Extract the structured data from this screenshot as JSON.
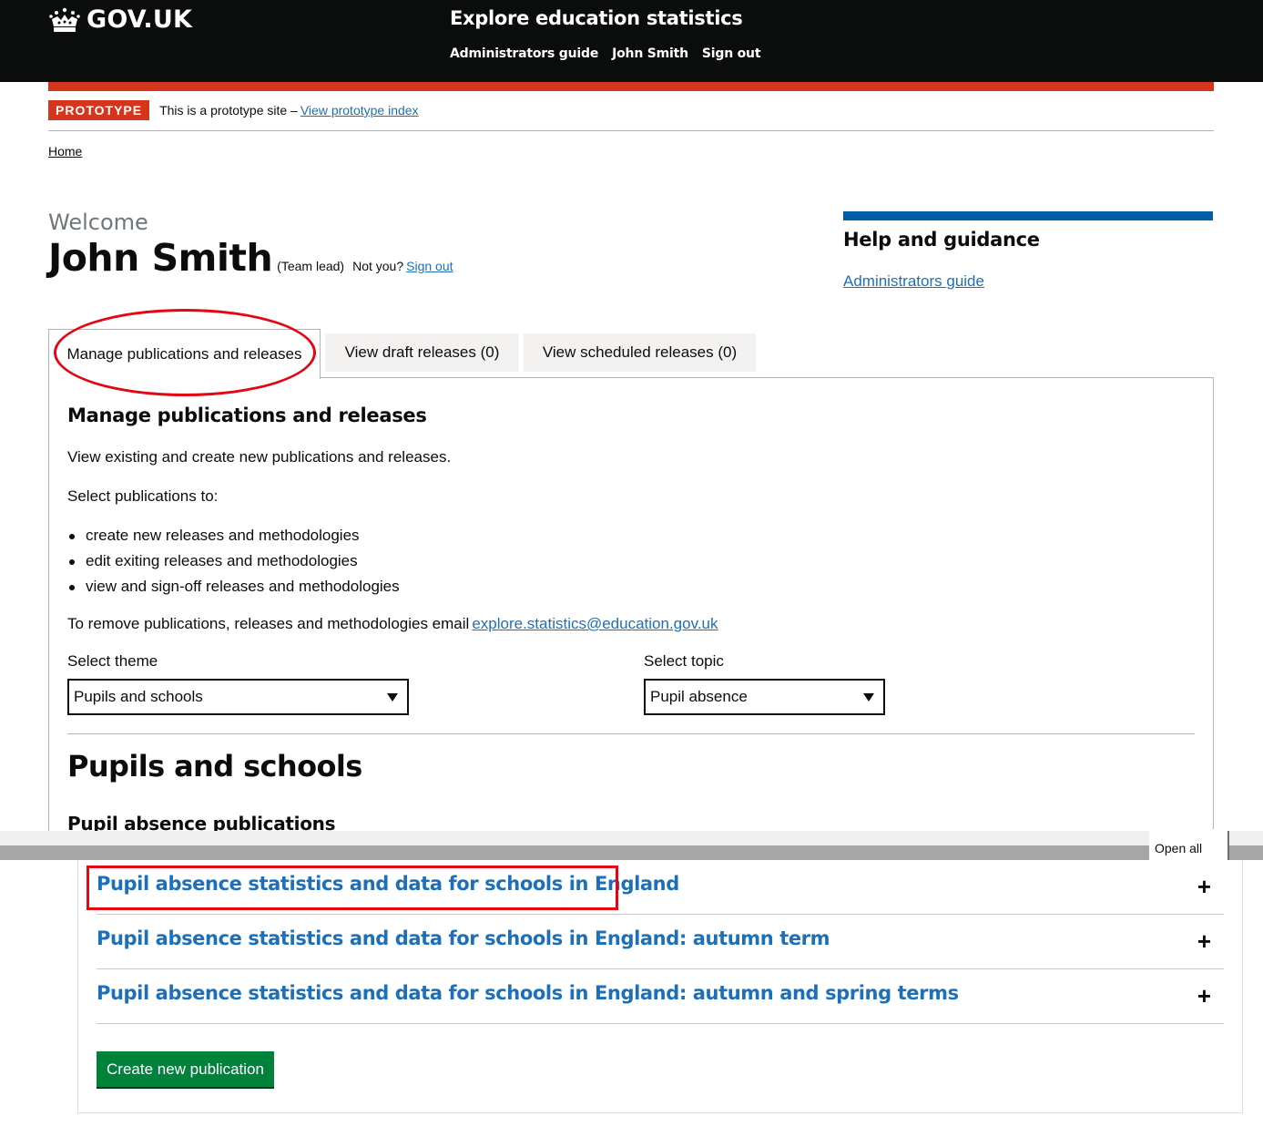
{
  "header": {
    "logo_text": "GOV.UK",
    "service_name": "Explore education statistics",
    "nav": [
      "Administrators guide",
      "John Smith",
      "Sign out"
    ]
  },
  "phase_banner": {
    "tag": "PROTOTYPE",
    "text": "This is a prototype site –",
    "link": "View prototype index"
  },
  "breadcrumb": {
    "home": "Home"
  },
  "welcome": {
    "greeting": "Welcome",
    "name": "John Smith",
    "role": "(Team lead)",
    "not_you": "Not you?",
    "sign_out": "Sign out"
  },
  "help": {
    "title": "Help and guidance",
    "link": "Administrators guide"
  },
  "tabs": [
    {
      "label": "Manage publications and releases",
      "active": true
    },
    {
      "label": "View draft releases (0)",
      "active": false
    },
    {
      "label": "View scheduled releases (0)",
      "active": false
    }
  ],
  "content": {
    "title": "Manage publications and releases",
    "intro": "View existing and create new publications and releases.",
    "select_intro": "Select publications to:",
    "bullets": [
      "create new releases and methodologies",
      "edit exiting releases and methodologies",
      "view and sign-off releases and methodologies"
    ],
    "remove_text": "To remove publications, releases and methodologies email",
    "email": "explore.statistics@education.gov.uk",
    "theme_label": "Select theme",
    "theme_value": "Pupils and schools",
    "topic_label": "Select topic",
    "topic_value": "Pupil absence",
    "theme_heading": "Pupils and schools",
    "publications_heading": "Pupil absence publications",
    "open_all": "Open all",
    "publications": [
      "Pupil absence statistics and data for schools in England",
      "Pupil absence statistics and data for schools in England: autumn term",
      "Pupil absence statistics and data for schools in England: autumn and spring terms"
    ],
    "create_button": "Create new publication"
  },
  "colors": {
    "header_bg": "#0b0c0c",
    "accent_red": "#d4351c",
    "link_blue": "#1d70b8",
    "help_bar": "#005ea5",
    "button_green": "#00823b",
    "annotation_red": "#e30613"
  }
}
